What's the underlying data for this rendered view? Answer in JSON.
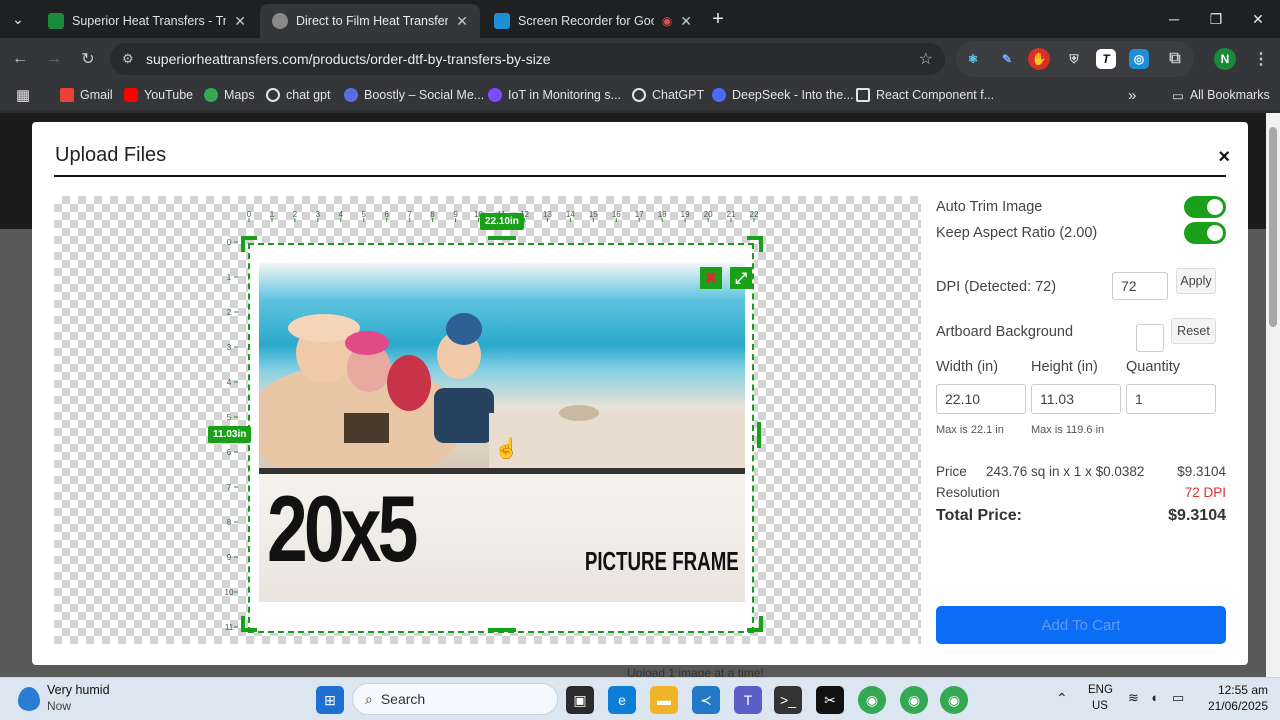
{
  "browser": {
    "tabs": [
      {
        "title": "Superior Heat Transfers - Trimly",
        "active": false,
        "color": "#1a8a3a"
      },
      {
        "title": "Direct to Film Heat Transfers By",
        "active": true,
        "color": "#8a8a8a"
      },
      {
        "title": "Screen Recorder for Google",
        "active": false,
        "color": "#1e8fd6"
      }
    ],
    "new_tab": "+",
    "url": "superiorheattransfers.com/products/order-dtf-by-transfers-by-size",
    "bookmarks": [
      "Gmail",
      "YouTube",
      "Maps",
      "chat gpt",
      "Boostly – Social Me...",
      "IoT in Monitoring s...",
      "ChatGPT",
      "DeepSeek - Into the...",
      "React Component f..."
    ],
    "all_bookmarks": "All Bookmarks",
    "profile_initial": "N"
  },
  "modal": {
    "title": "Upload Files",
    "close": "×",
    "width_badge": "22.10in",
    "height_badge": "11.03in",
    "ruler_h": [
      "0",
      "1",
      "2",
      "3",
      "4",
      "5",
      "6",
      "7",
      "8",
      "9",
      "10",
      "11",
      "12",
      "13",
      "14",
      "15",
      "16",
      "17",
      "18",
      "19",
      "20",
      "21",
      "22"
    ],
    "ruler_v": [
      "0",
      "1",
      "2",
      "3",
      "4",
      "5",
      "6",
      "7",
      "8",
      "9",
      "10",
      "11"
    ],
    "image_text_size": "20x5",
    "image_text_caption": "PICTURE FRAME",
    "upload_note": "Upload 1 image at a time!"
  },
  "settings": {
    "auto_trim_label": "Auto Trim Image",
    "keep_aspect_label": "Keep Aspect Ratio (2.00)",
    "dpi_label": "DPI (Detected: 72)",
    "dpi_value": "72",
    "apply_label": "Apply",
    "artboard_label": "Artboard Background",
    "reset_label": "Reset",
    "width_label": "Width (in)",
    "height_label": "Height (in)",
    "quantity_label": "Quantity",
    "width_value": "22.10",
    "height_value": "11.03",
    "quantity_value": "1",
    "width_hint": "Max is 22.1 in",
    "height_hint": "Max is 119.6 in",
    "price_label": "Price",
    "price_formula": "243.76 sq in x 1 x $0.0382",
    "price_value": "$9.3104",
    "resolution_label": "Resolution",
    "resolution_value": "72 DPI",
    "total_label": "Total Price:",
    "total_value": "$9.3104",
    "add_to_cart": "Add To Cart"
  },
  "taskbar": {
    "weather_title": "Very humid",
    "weather_sub": "Now",
    "search_placeholder": "Search",
    "lang_top": "ENG",
    "lang_bottom": "US",
    "time": "12:55 am",
    "date": "21/06/2025"
  }
}
